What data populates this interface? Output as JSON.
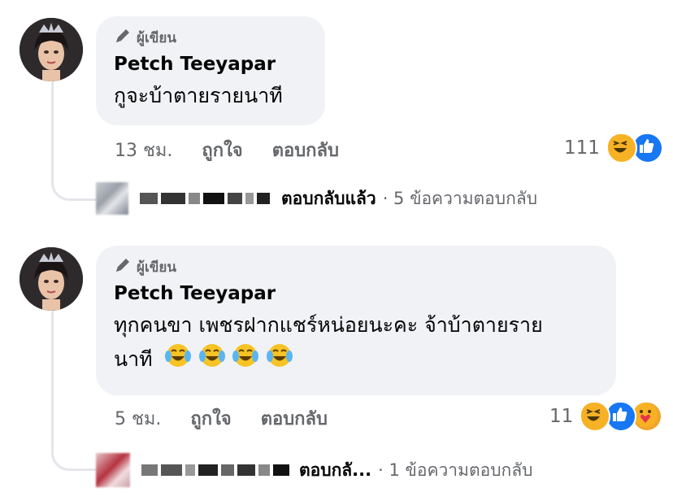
{
  "colors": {
    "bubble_bg": "#f0f2f5",
    "secondary_text": "#65676b",
    "haha": "#f7b125",
    "like": "#1877f2",
    "care": "#f0a62b"
  },
  "comments": [
    {
      "badge_icon": "pen-icon",
      "badge_label": "ผู้เขียน",
      "author": "Petch Teeyapar",
      "text_line1": "กูจะบ้าตายรายนาที",
      "time": "13 ชม.",
      "like_label": "ถูกใจ",
      "reply_label": "ตอบกลับ",
      "reaction_count": "111",
      "reaction_icons": [
        "haha-icon",
        "like-icon"
      ],
      "reply_author_blurred": true,
      "reply_status": "ตอบกลับแล้ว",
      "reply_summary": "· 5 ข้อความตอบกลับ"
    },
    {
      "badge_icon": "pen-icon",
      "badge_label": "ผู้เขียน",
      "author": "Petch Teeyapar",
      "text_line1": "ทุกคนขา เพชรฝากแชร์หน่อยนะคะ จ้าบ้าตายราย",
      "text_line2": "นาที",
      "text_emojis": [
        "tears-of-joy-icon",
        "tears-of-joy-icon",
        "tears-of-joy-icon",
        "tears-of-joy-icon"
      ],
      "time": "5 ชม.",
      "like_label": "ถูกใจ",
      "reply_label": "ตอบกลับ",
      "reaction_count": "11",
      "reaction_icons": [
        "haha-icon",
        "like-icon",
        "care-icon"
      ],
      "reply_author_blurred": true,
      "reply_status": "ตอบกลั...",
      "reply_summary": "· 1 ข้อความตอบกลับ"
    }
  ]
}
